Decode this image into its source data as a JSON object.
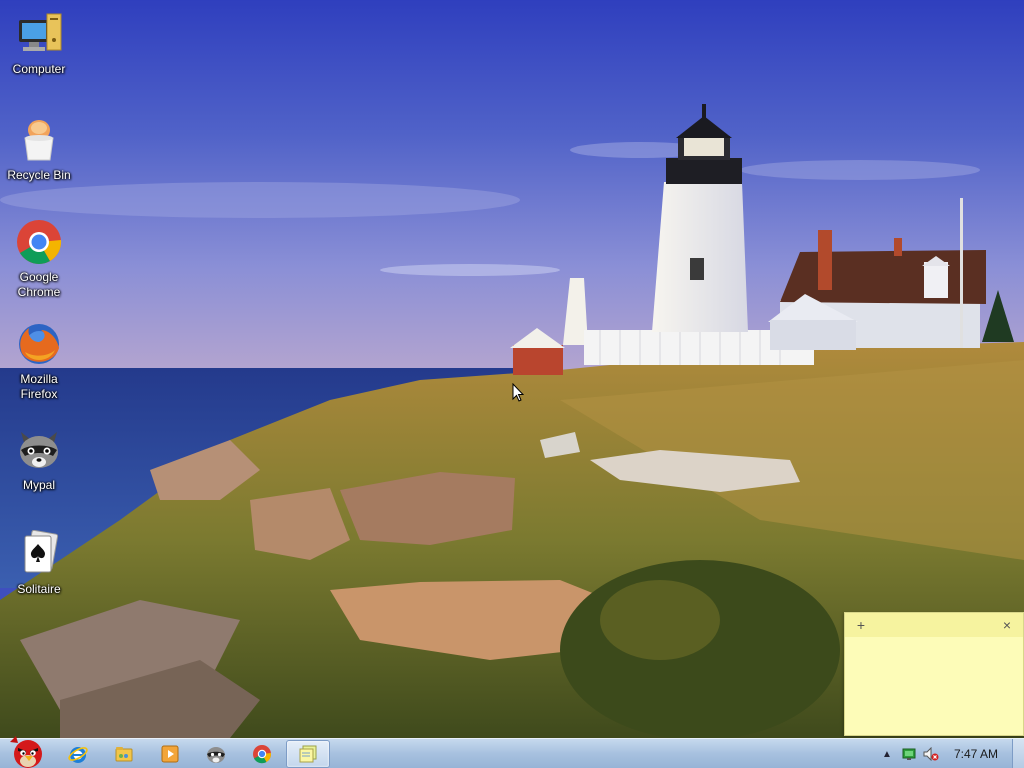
{
  "desktop": {
    "icons": [
      {
        "label": "Computer",
        "icon": "computer-icon"
      },
      {
        "label": "Recycle Bin",
        "icon": "recycle-bin-icon"
      },
      {
        "label": "Google Chrome",
        "icon": "chrome-icon"
      },
      {
        "label": "Mozilla Firefox",
        "icon": "firefox-icon"
      },
      {
        "label": "Mypal",
        "icon": "mypal-raccoon-icon"
      },
      {
        "label": "Solitaire",
        "icon": "solitaire-icon"
      }
    ]
  },
  "sticky_note": {
    "add_label": "+",
    "close_label": "×",
    "text": ""
  },
  "taskbar": {
    "start_icon": "angry-bird-start-icon",
    "pinned": [
      {
        "icon": "internet-explorer-icon"
      },
      {
        "icon": "windows-explorer-icon"
      },
      {
        "icon": "media-player-icon"
      },
      {
        "icon": "mypal-raccoon-icon"
      },
      {
        "icon": "chrome-icon"
      },
      {
        "icon": "sticky-notes-icon",
        "active": true
      }
    ],
    "tray": {
      "show_hidden_label": "▲",
      "clock": "7:47 AM"
    }
  },
  "colors": {
    "taskbar": "#a7c1df",
    "sticky": "#fdfcb8",
    "sky": "#3a4fc8"
  }
}
